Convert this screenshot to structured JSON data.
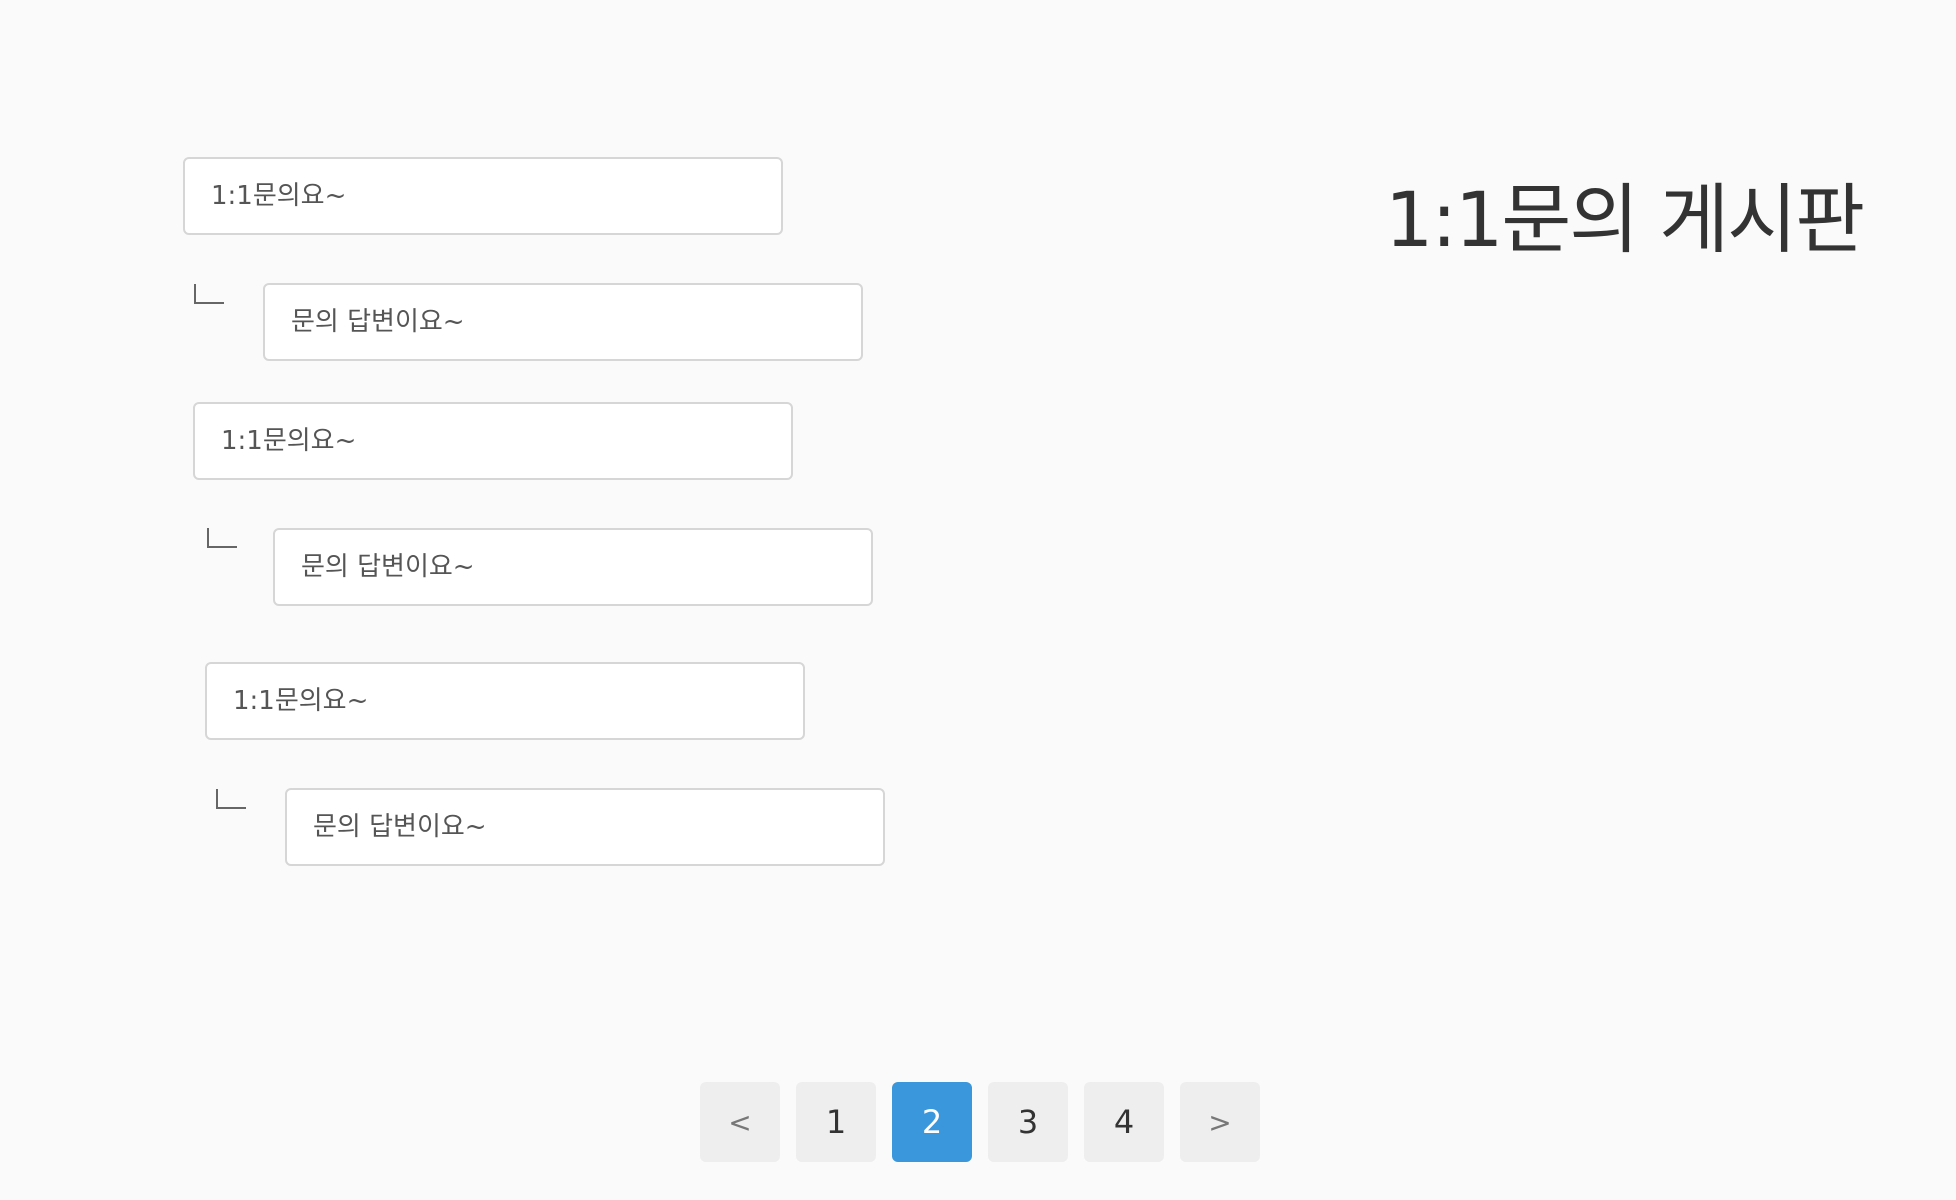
{
  "board": {
    "title": "1:1문의 게시판"
  },
  "entries": [
    {
      "question": "1:1문의요~",
      "reply": "문의 답변이요~"
    },
    {
      "question": "1:1문의요~",
      "reply": "문의 답변이요~"
    },
    {
      "question": "1:1문의요~",
      "reply": "문의 답변이요~"
    }
  ],
  "pagination": {
    "prev": "<",
    "pages": [
      "1",
      "2",
      "3",
      "4"
    ],
    "next": ">",
    "current": "2",
    "active_color": "#3a97db"
  }
}
